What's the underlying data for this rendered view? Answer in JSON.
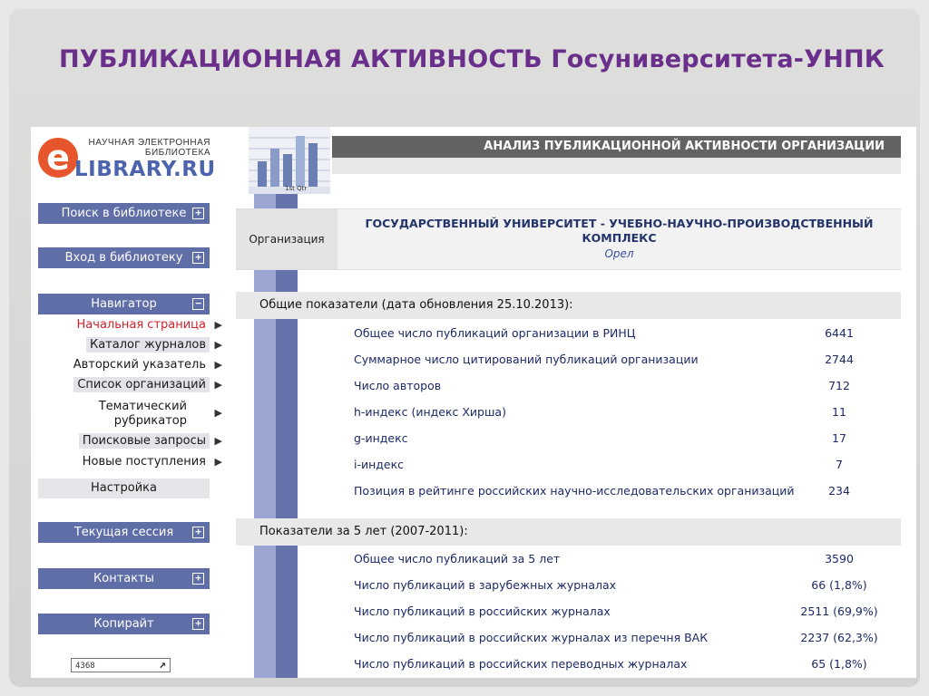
{
  "slide": {
    "title": "ПУБЛИКАЦИОННАЯ АКТИВНОСТЬ Госуниверситета-УНПК"
  },
  "logo": {
    "line1": "НАУЧНАЯ ЭЛЕКТРОННАЯ",
    "line2": "БИБЛИОТЕКА",
    "letter": "e",
    "brand": "LIBRARY.RU"
  },
  "sidebar": {
    "search": "Поиск в библиотеке",
    "login": "Вход в библиотеку",
    "navigator": "Навигатор",
    "nav_items": [
      {
        "label": "Начальная страница"
      },
      {
        "label": "Каталог журналов"
      },
      {
        "label": "Авторский указатель"
      },
      {
        "label": "Список организаций"
      },
      {
        "label": "Тематический рубрикатор"
      },
      {
        "label": "Поисковые запросы"
      },
      {
        "label": "Новые поступления"
      }
    ],
    "settings": "Настройка",
    "session": "Текущая сессия",
    "contacts": "Контакты",
    "copyright": "Копирайт",
    "counter": "4368"
  },
  "header": {
    "title": "АНАЛИЗ ПУБЛИКАЦИОННОЙ АКТИВНОСТИ ОРГАНИЗАЦИИ",
    "thumb_label": "1st Qtr"
  },
  "organization": {
    "label": "Организация",
    "name_line1": "ГОСУДАРСТВЕННЫЙ УНИВЕРСИТЕТ - УЧЕБНО-НАУЧНО-ПРОИЗВОДСТВЕННЫЙ",
    "name_line2": "КОМПЛЕКС",
    "city": "Орел"
  },
  "general": {
    "heading": "Общие показатели (дата обновления 25.10.2013):",
    "rows": [
      {
        "label": "Общее число публикаций организации в РИНЦ",
        "value": "6441"
      },
      {
        "label": "Суммарное число цитирований публикаций организации",
        "value": "2744"
      },
      {
        "label": "Число авторов",
        "value": "712"
      },
      {
        "label": "h-индекс (индекс Хирша)",
        "value": "11"
      },
      {
        "label": "g-индекс",
        "value": "17"
      },
      {
        "label": "i-индекс",
        "value": "7"
      },
      {
        "label": "Позиция в рейтинге российских научно-исследовательских организаций",
        "value": "234"
      }
    ]
  },
  "five_years": {
    "heading": "Показатели за 5 лет (2007-2011):",
    "rows": [
      {
        "label": "Общее число публикаций за 5 лет",
        "value": "3590"
      },
      {
        "label": "Число публикаций в зарубежных журналах",
        "value": "66 (1,8%)"
      },
      {
        "label": "Число публикаций в российских журналах",
        "value": "2511 (69,9%)"
      },
      {
        "label": "Число публикаций в российских журналах из перечня ВАК",
        "value": "2237 (62,3%)"
      },
      {
        "label": "Число публикаций в российских переводных журналах",
        "value": "65 (1,8%)"
      }
    ]
  },
  "colors": {
    "title": "#6a2f8a",
    "sidebar_button": "#5f6ea7",
    "header_bar": "#636363",
    "active_link": "#d6202a",
    "logo_e": "#e7552c",
    "logo_brand": "#4b64ad"
  }
}
